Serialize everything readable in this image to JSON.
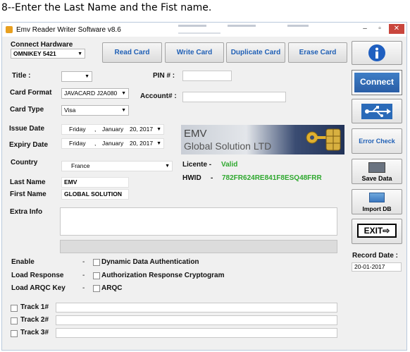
{
  "caption": "8--Enter the Last Name and the Fist name.",
  "window": {
    "title": "Emv Reader Writer Software v8.6"
  },
  "hardware": {
    "label": "Connect Hardware",
    "value": "OMNIKEY 5421"
  },
  "buttons": {
    "read": "Read Card",
    "write": "Write Card",
    "duplicate": "Duplicate Card",
    "erase": "Erase Card"
  },
  "side": {
    "connect": "Connect",
    "error_check": "Error Check",
    "save_data": "Save Data",
    "import_db": "Import DB",
    "exit": "EXIT",
    "record_date_label": "Record Date :",
    "record_date": "20-01-2017"
  },
  "form": {
    "title_label": "Title :",
    "title_value": "",
    "pin_label": "PIN # :",
    "pin_value": "",
    "card_format_label": "Card Format",
    "card_format_value": "JAVACARD J2A080",
    "account_label": "Account# :",
    "account_value": "",
    "card_type_label": "Card Type",
    "card_type_value": "Visa",
    "issue_date_label": "Issue Date",
    "issue_date": {
      "day": "Friday",
      "month": "January",
      "date": "20, 2017"
    },
    "expiry_date_label": "Expiry Date",
    "expiry_date": {
      "day": "Friday",
      "month": "January",
      "date": "20, 2017"
    },
    "country_label": "Country",
    "country_value": "France",
    "last_name_label": "Last Name",
    "last_name_value": "EMV",
    "first_name_label": "First Name",
    "first_name_value": "GLOBAL SOLUTION",
    "extra_info_label": "Extra Info",
    "extra_info_value": ""
  },
  "banner": {
    "line1": "EMV",
    "line2": "Global Solution LTD"
  },
  "licence": {
    "label": "Licente -",
    "status": "Valid",
    "hwid_label": "HWID",
    "hwid_dash": "-",
    "hwid_value": "782FR624RE841F8ESQ48FRR"
  },
  "options": [
    {
      "label": "Enable",
      "dash": "-",
      "text": "Dynamic Data Authentication"
    },
    {
      "label": "Load Response",
      "dash": "-",
      "text": "Authorization Response Cryptogram"
    },
    {
      "label": "Load ARQC Key",
      "dash": "-",
      "text": "ARQC"
    }
  ],
  "tracks": [
    {
      "label": "Track 1#"
    },
    {
      "label": "Track 2#"
    },
    {
      "label": "Track 3#"
    }
  ],
  "colors": {
    "accent": "#1f5fb5",
    "valid": "#2ea82e",
    "connect_bg": "#2f6db5"
  }
}
